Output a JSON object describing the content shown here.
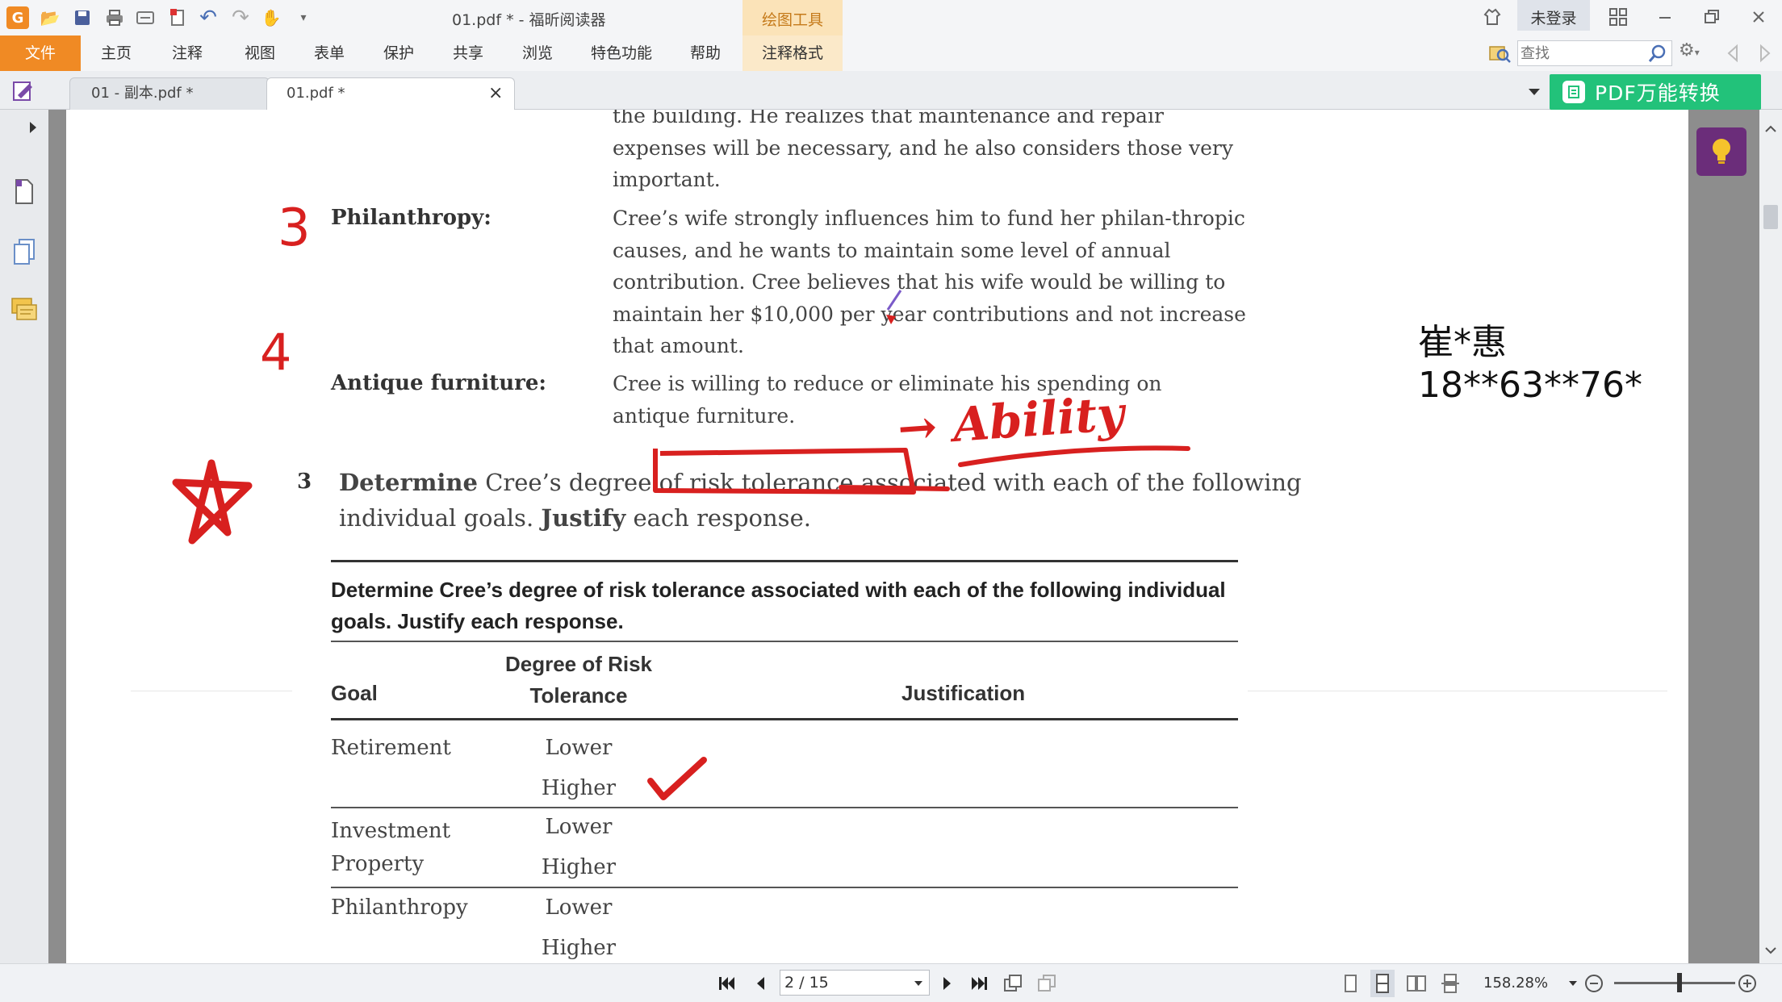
{
  "titlebar": {
    "title": "01.pdf * - 福昕阅读器",
    "tool_context": "绘图工具",
    "login": "未登录"
  },
  "menu": {
    "file": "文件",
    "items": [
      "主页",
      "注释",
      "视图",
      "表单",
      "保护",
      "共享",
      "浏览",
      "特色功能",
      "帮助",
      "注释格式"
    ]
  },
  "search": {
    "placeholder": "查找"
  },
  "tabs": [
    {
      "label": "01 - 副本.pdf *"
    },
    {
      "label": "01.pdf *"
    }
  ],
  "convert_button": "PDF万能转换",
  "watermark": "崔*惠 18**63**76*",
  "document": {
    "top_text": "the building. He realizes that maintenance and repair expenses will be necessary, and he also considers those very important.",
    "philanthropy_label": "Philanthropy:",
    "philanthropy_text": "Cree’s wife strongly influences him to fund her philan-thropic causes, and he wants to maintain some level of annual contribution. Cree believes that his wife would be willing to maintain her $10,000 per year contributions and not increase that amount.",
    "antique_label": "Antique furniture:",
    "antique_text": "Cree is willing to reduce or eliminate his spending on antique furniture.",
    "question_number": "3",
    "question_bold1": "Determine",
    "question_text1": "Cree’s degree of risk tolerance associated with each of the following individual goals.",
    "question_bold2": "Justify",
    "question_text2": "each response.",
    "box_heading": "Determine Cree’s degree of risk tolerance associated with each of the following individual goals. Justify each response.",
    "table": {
      "headers": [
        "Goal",
        "Degree of Risk Tolerance",
        "Justification"
      ],
      "rows": [
        {
          "goal": "Retirement",
          "options": [
            "Lower",
            "Higher"
          ]
        },
        {
          "goal": "Investment Property",
          "options": [
            "Lower",
            "Higher"
          ]
        },
        {
          "goal": "Philanthropy",
          "options": [
            "Lower",
            "Higher"
          ]
        }
      ]
    }
  },
  "annotations": {
    "num3": "3",
    "num4": "4",
    "ability": "→ Ability"
  },
  "status": {
    "page_input": "2 / 15",
    "zoom": "158.28%"
  }
}
